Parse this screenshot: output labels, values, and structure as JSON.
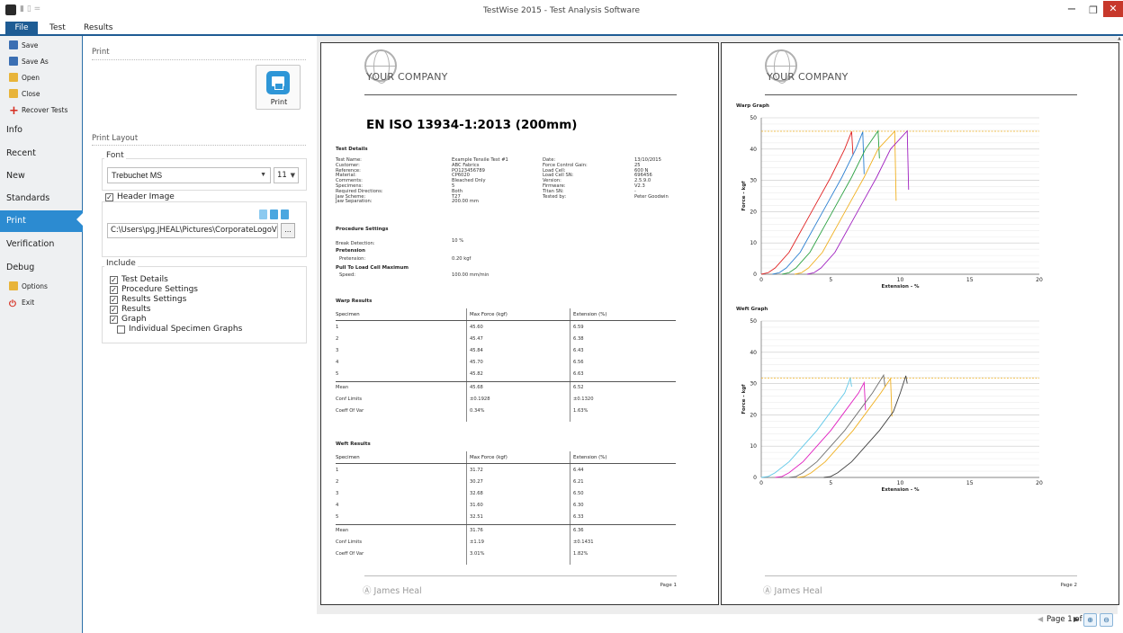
{
  "window": {
    "title": "TestWise 2015 - Test Analysis Software",
    "qat": "▮ ▯ =",
    "min": "−",
    "max": "❐",
    "close": "✕"
  },
  "menu": {
    "file": "File",
    "test": "Test",
    "results": "Results"
  },
  "sidebar": {
    "commands": [
      {
        "label": "Save",
        "icon": "save-icon",
        "color": "#3b6fb3"
      },
      {
        "label": "Save As",
        "icon": "save-as-icon",
        "color": "#3b6fb3"
      },
      {
        "label": "Open",
        "icon": "open-folder-icon",
        "color": "#e8b43a"
      },
      {
        "label": "Close",
        "icon": "close-folder-icon",
        "color": "#e8b43a"
      },
      {
        "label": "Recover Tests",
        "icon": "plus-icon",
        "color": "#d62d20"
      }
    ],
    "items": [
      "Info",
      "Recent",
      "New",
      "Standards",
      "Print",
      "Verification",
      "Debug"
    ],
    "options": {
      "label": "Options",
      "icon": "options-icon"
    },
    "exit": {
      "label": "Exit",
      "icon": "power-icon"
    }
  },
  "settings": {
    "print_title": "Print",
    "print_button": "Print",
    "layout_title": "Print Layout",
    "font_group": "Font",
    "font_name": "Trebuchet MS",
    "font_size": "11",
    "header_image_label": "Header Image",
    "header_image_checked": true,
    "header_image_path": "C:\\Users\\pg.JHEAL\\Pictures\\CorporateLogoV",
    "browse": "...",
    "include_group": "Include",
    "include_items": [
      {
        "label": "Test Details",
        "checked": true
      },
      {
        "label": "Procedure Settings",
        "checked": true
      },
      {
        "label": "Results Settings",
        "checked": true
      },
      {
        "label": "Results",
        "checked": true
      },
      {
        "label": "Graph",
        "checked": true
      },
      {
        "label": "Individual Specimen Graphs",
        "checked": false
      }
    ]
  },
  "report": {
    "company": "YOUR COMPANY",
    "title": "EN ISO 13934-1:2013 (200mm)",
    "test_details_title": "Test Details",
    "details_left": [
      [
        "Test Name:",
        "Example Tensile Test #1"
      ],
      [
        "Customer:",
        "ABC Fabrics"
      ],
      [
        "Reference:",
        "PO123456789"
      ],
      [
        "Material:",
        "CP6020"
      ],
      [
        "Comments:",
        "Bleached Only"
      ],
      [
        "Specimens:",
        "5"
      ],
      [
        "Required Directions:",
        "Both"
      ],
      [
        "Jaw Scheme:",
        "T27"
      ],
      [
        "Jaw Separation:",
        "200.00 mm"
      ]
    ],
    "details_right": [
      [
        "Date:",
        "13/10/2015"
      ],
      [
        "Force Control Gain:",
        "25"
      ],
      [
        "Load Cell:",
        "600 N"
      ],
      [
        "Load Cell SN:",
        "696456"
      ],
      [
        "Version:",
        "2.5.9.0"
      ],
      [
        "Firmware:",
        "V2.3"
      ],
      [
        "Titan SN:",
        "-"
      ],
      [
        "Tested by:",
        "Peter Goodwin"
      ]
    ],
    "procedure_title": "Procedure Settings",
    "break_detection_label": "Break Detection:",
    "break_detection_value": "10 %",
    "pretension_title": "Pretension",
    "pretension_label": "Pretension:",
    "pretension_value": "0.20 kgf",
    "pull_title": "Pull To Load Cell Maximum",
    "speed_label": "Speed:",
    "speed_value": "100.00 mm/min",
    "columns": [
      "Specimen",
      "Max Force (kgf)",
      "Extension (%)"
    ],
    "warp_title": "Warp Results",
    "warp_rows": [
      [
        "1",
        "45.60",
        "6.59"
      ],
      [
        "2",
        "45.47",
        "6.38"
      ],
      [
        "3",
        "45.84",
        "6.43"
      ],
      [
        "4",
        "45.70",
        "6.56"
      ],
      [
        "5",
        "45.82",
        "6.63"
      ]
    ],
    "warp_stats": [
      [
        "Mean",
        "45.68",
        "6.52"
      ],
      [
        "Conf Limits",
        "±0.1928",
        "±0.1320"
      ],
      [
        "Coeff Of Var",
        "0.34%",
        "1.63%"
      ]
    ],
    "weft_title": "Weft Results",
    "weft_rows": [
      [
        "1",
        "31.72",
        "6.44"
      ],
      [
        "2",
        "30.27",
        "6.21"
      ],
      [
        "3",
        "32.68",
        "6.50"
      ],
      [
        "4",
        "31.60",
        "6.30"
      ],
      [
        "5",
        "32.51",
        "6.33"
      ]
    ],
    "weft_stats": [
      [
        "Mean",
        "31.76",
        "6.36"
      ],
      [
        "Conf Limits",
        "±1.19",
        "±0.1431"
      ],
      [
        "Coeff Of Var",
        "3.01%",
        "1.82%"
      ]
    ],
    "footer_logo": "Ⓐ James Heal",
    "page1_label": "Page 1",
    "page2_label": "Page 2"
  },
  "chart_data": [
    {
      "type": "line",
      "title": "Warp Graph",
      "xlabel": "Extension - %",
      "ylabel": "Force - kgf",
      "xlim": [
        0,
        20
      ],
      "ylim": [
        0,
        50
      ],
      "xticks": [
        0,
        5,
        10,
        15,
        20
      ],
      "yticks": [
        0,
        10,
        20,
        30,
        40,
        50
      ],
      "reference_line": 45.68,
      "series": [
        {
          "color": "#e02020",
          "x": [
            0,
            0.5,
            1,
            2,
            3,
            4,
            5,
            6,
            6.5,
            6.6
          ],
          "y": [
            0,
            0.5,
            2,
            7,
            15,
            23,
            31,
            40,
            45.6,
            38
          ]
        },
        {
          "color": "#2a7fd0",
          "x": [
            0.8,
            1.3,
            1.8,
            2.8,
            3.8,
            4.8,
            5.8,
            6.8,
            7.3,
            7.4
          ],
          "y": [
            0,
            0.5,
            2,
            7,
            15,
            23,
            31,
            40,
            45.5,
            32
          ]
        },
        {
          "color": "#2aa040",
          "x": [
            1.5,
            2,
            2.5,
            3.5,
            4.5,
            5.5,
            6.5,
            7.5,
            8.4,
            8.5
          ],
          "y": [
            0,
            0.5,
            2,
            7,
            15,
            23,
            31,
            40,
            45.8,
            37
          ]
        },
        {
          "color": "#f0b020",
          "x": [
            2.4,
            2.9,
            3.4,
            4.4,
            5.4,
            6.4,
            7.4,
            8.4,
            9.6,
            9.7
          ],
          "y": [
            0,
            0.5,
            2,
            7,
            15,
            23,
            31,
            40,
            45.7,
            23.5
          ]
        },
        {
          "color": "#a020c0",
          "x": [
            3.3,
            3.8,
            4.3,
            5.3,
            6.3,
            7.3,
            8.3,
            9.3,
            10.5,
            10.6
          ],
          "y": [
            0,
            0.5,
            2,
            7,
            15,
            23,
            31,
            40,
            45.8,
            27
          ]
        }
      ]
    },
    {
      "type": "line",
      "title": "Weft Graph",
      "xlabel": "Extension - %",
      "ylabel": "Force - kgf",
      "xlim": [
        0,
        20
      ],
      "ylim": [
        0,
        50
      ],
      "xticks": [
        0,
        5,
        10,
        15,
        20
      ],
      "yticks": [
        0,
        10,
        20,
        30,
        40,
        50
      ],
      "reference_line": 31.76,
      "series": [
        {
          "color": "#60c8e8",
          "x": [
            0,
            0.5,
            1,
            2,
            3,
            4,
            5,
            6,
            6.4,
            6.5
          ],
          "y": [
            0,
            0.3,
            1.5,
            5,
            10,
            15,
            21,
            27,
            31.7,
            29
          ]
        },
        {
          "color": "#e020c0",
          "x": [
            1,
            1.5,
            2,
            3,
            4,
            5,
            6,
            7,
            7.4,
            7.5
          ],
          "y": [
            0,
            0.3,
            1.5,
            5,
            10,
            15,
            21,
            27,
            30.3,
            21.5
          ]
        },
        {
          "color": "#707070",
          "x": [
            2,
            2.5,
            3,
            4,
            5,
            6,
            7,
            8,
            8.8,
            8.9
          ],
          "y": [
            0,
            0.3,
            1.5,
            5,
            10,
            15,
            21,
            27,
            32.7,
            29
          ]
        },
        {
          "color": "#f0b020",
          "x": [
            2.6,
            3.1,
            3.6,
            4.6,
            5.6,
            6.6,
            7.6,
            8.6,
            9.3,
            9.4
          ],
          "y": [
            0,
            0.3,
            1.5,
            5,
            10,
            15,
            21,
            27,
            31.6,
            19.5
          ]
        },
        {
          "color": "#404040",
          "x": [
            4.5,
            5,
            5.5,
            6.5,
            7.5,
            8.5,
            9.5,
            10,
            10.4,
            10.5
          ],
          "y": [
            0,
            0.3,
            1.5,
            5,
            10,
            15,
            21,
            27,
            32.5,
            30
          ]
        }
      ]
    }
  ],
  "pager": {
    "label": "Page 1 of 2",
    "prev": "◀",
    "next": "▶",
    "zoom_in": "⊕",
    "zoom_out": "⊖"
  }
}
